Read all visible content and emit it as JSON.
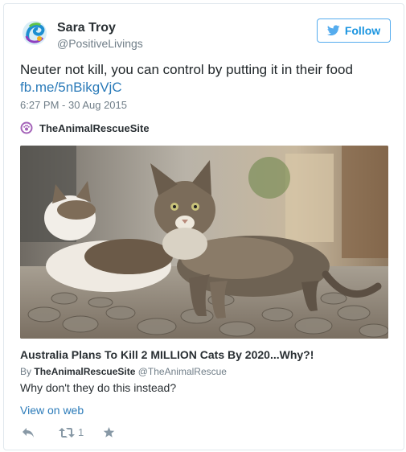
{
  "user": {
    "display_name": "Sara Troy",
    "handle": "@PositiveLivings",
    "avatar_icon": "swirl-logo-avatar"
  },
  "follow": {
    "label": "Follow",
    "icon": "twitter-bird-icon",
    "color": "#1b95e0"
  },
  "tweet": {
    "text": "Neuter not kill, you can control by putting it in their food",
    "link": "fb.me/5nBikgVjC",
    "timestamp": "6:27 PM - 30 Aug 2015"
  },
  "source": {
    "name": "TheAnimalRescueSite",
    "icon": "animal-rescue-logo-icon"
  },
  "card": {
    "image_alt_icon": "cats-photo",
    "title": "Australia Plans To Kill 2 MILLION Cats By 2020...Why?!",
    "byline_prefix": "By",
    "byline_site": "TheAnimalRescueSite",
    "byline_handle": "@TheAnimalRescue",
    "description": "Why don't they do this instead?"
  },
  "view_on_web": "View on web",
  "actions": {
    "reply_icon": "reply-icon",
    "retweet_icon": "retweet-icon",
    "retweet_count": "1",
    "like_icon": "star-icon"
  },
  "colors": {
    "link": "#2b7bb9",
    "muted": "#707e88",
    "action": "#8899a6",
    "border": "#e1e8ed"
  }
}
